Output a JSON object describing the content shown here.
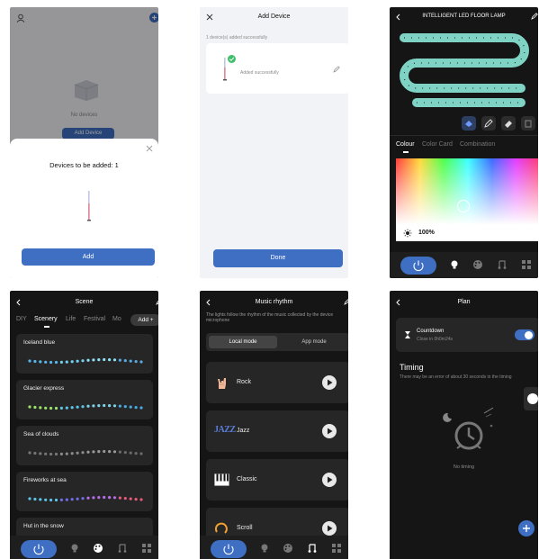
{
  "screen1": {
    "empty_text": "No devices",
    "add_device_label": "Add Device",
    "sheet_title": "Devices to be added: 1",
    "add_button": "Add"
  },
  "screen2": {
    "title": "Add Device",
    "count_text": "1 device(s) added successfully",
    "device_status": "Added successfully",
    "done_button": "Done"
  },
  "screen3": {
    "title": "INTELLIGENT LED FLOOR LAMP",
    "tabs": [
      "Colour",
      "Color Card",
      "Combination"
    ],
    "brightness": "100%",
    "colors": {
      "strip": "#7fd3c4",
      "accent": "#3e6fc2"
    }
  },
  "screen4": {
    "title": "Scene",
    "tabs": [
      "DIY",
      "Scenery",
      "Life",
      "Festival",
      "Mo"
    ],
    "add_button": "Add +",
    "scenes": [
      {
        "name": "Iceland blue"
      },
      {
        "name": "Glacier express"
      },
      {
        "name": "Sea of clouds"
      },
      {
        "name": "Fireworks at sea"
      },
      {
        "name": "Hut in the snow"
      }
    ]
  },
  "screen5": {
    "title": "Music rhythm",
    "description": "The lights follow the rhythm of the music collected by the device microphone",
    "modes": [
      "Local mode",
      "App mode"
    ],
    "items": [
      "Rock",
      "Jazz",
      "Classic",
      "Scroll"
    ],
    "jazz_icon_text": "JAZZ"
  },
  "screen6": {
    "title": "Plan",
    "countdown_label": "Countdown",
    "countdown_value": "Close in 0h0m24s",
    "timing_title": "Timing",
    "timing_note": "There may be an error of about 30 seconds in the timing",
    "no_timing": "No timing"
  }
}
